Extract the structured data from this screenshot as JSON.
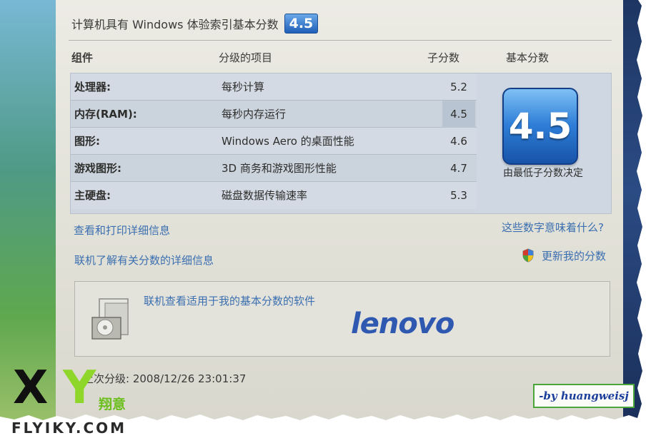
{
  "header": {
    "title": "计算机具有 Windows 体验索引基本分数",
    "badge": "4.5"
  },
  "columns": {
    "component": "组件",
    "rated_item": "分级的项目",
    "subscore": "子分数",
    "base_score": "基本分数"
  },
  "rows": [
    {
      "component": "处理器:",
      "item": "每秒计算",
      "score": "5.2"
    },
    {
      "component": "内存(RAM):",
      "item": "每秒内存运行",
      "score": "4.5"
    },
    {
      "component": "图形:",
      "item": "Windows Aero 的桌面性能",
      "score": "4.6"
    },
    {
      "component": "游戏图形:",
      "item": "3D 商务和游戏图形性能",
      "score": "4.7"
    },
    {
      "component": "主硬盘:",
      "item": "磁盘数据传输速率",
      "score": "5.3"
    }
  ],
  "base": {
    "score": "4.5",
    "caption": "由最低子分数决定"
  },
  "links": {
    "view_print": "查看和打印详细信息",
    "what_mean": "这些数字意味着什么?",
    "learn_online": "联机了解有关分数的详细信息",
    "update": "更新我的分数"
  },
  "software_box": {
    "link": "联机查看适用于我的基本分数的软件",
    "brand": "lenovo"
  },
  "last_rating": "上次分级: 2008/12/26 23:01:37",
  "watermark": {
    "x": "X",
    "y": "Y",
    "cn": "翔意",
    "site": "FLYIKY.COM"
  },
  "signature": "-by huangweisj",
  "colors": {
    "link": "#3b6fb0",
    "badge_blue": "#1f5fb8",
    "watermark_green": "#8ed62a",
    "signature_border": "#4aa63a"
  }
}
